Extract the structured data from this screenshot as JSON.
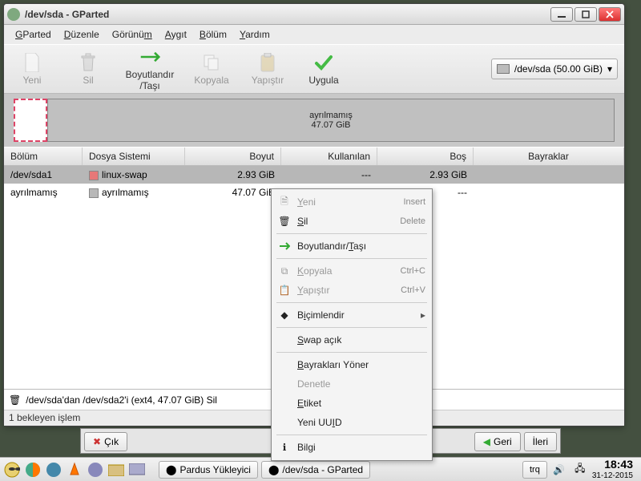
{
  "window": {
    "title": "/dev/sda - GParted"
  },
  "menu": {
    "gparted": "GParted",
    "duzenle": "Düzenle",
    "gorunum": "Görünüm",
    "aygit": "Aygıt",
    "bolum": "Bölüm",
    "yardim": "Yardım"
  },
  "toolbar": {
    "yeni": "Yeni",
    "sil": "Sil",
    "boyut": "Boyutlandır\n/Taşı",
    "kopyala": "Kopyala",
    "yapistir": "Yapıştır",
    "uygula": "Uygula",
    "device": "/dev/sda  (50.00 GiB)"
  },
  "graph": {
    "unalloc_label": "ayrılmamış",
    "unalloc_size": "47.07 GiB"
  },
  "columns": {
    "bolum": "Bölüm",
    "dosya": "Dosya Sistemi",
    "boyut": "Boyut",
    "kullanilan": "Kullanılan",
    "bos": "Boş",
    "bayraklar": "Bayraklar"
  },
  "rows": [
    {
      "part": "/dev/sda1",
      "fs": "linux-swap",
      "size": "2.93 GiB",
      "used": "---",
      "free": "2.93 GiB",
      "flags": ""
    },
    {
      "part": "ayrılmamış",
      "fs": "ayrılmamış",
      "size": "47.07 GiB",
      "used": "---",
      "free": "---",
      "flags": ""
    }
  ],
  "pending": {
    "op": "/dev/sda'dan /dev/sda2'i (ext4, 47.07 GiB) Sil"
  },
  "status": "1 bekleyen işlem",
  "ctx": {
    "yeni": "Yeni",
    "yeni_k": "Insert",
    "sil": "Sil",
    "sil_k": "Delete",
    "boyut": "Boyutlandır/Taşı",
    "kopyala": "Kopyala",
    "kopyala_k": "Ctrl+C",
    "yapistir": "Yapıştır",
    "yapistir_k": "Ctrl+V",
    "bicim": "Biçimlendir",
    "swap": "Swap açık",
    "bayrak": "Bayrakları Yöner",
    "denetle": "Denetle",
    "etiket": "Etiket",
    "uuid": "Yeni UUID",
    "bilgi": "Bilgi"
  },
  "peek": {
    "cik": "Çık",
    "geri": "Geri",
    "ileri": "İleri"
  },
  "taskbar": {
    "installer": "Pardus Yükleyici",
    "gparted": "/dev/sda - GParted",
    "kbd": "trq",
    "time": "18:43",
    "date": "31-12-2015"
  }
}
